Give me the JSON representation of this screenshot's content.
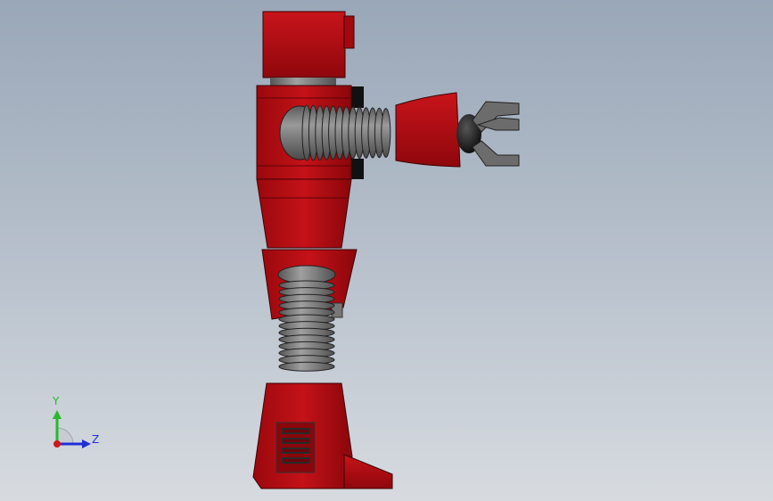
{
  "triad": {
    "y_label": "Y",
    "z_label": "Z",
    "y_color": "#2bb82b",
    "z_color": "#1e2fd8",
    "x_color": "#d01818"
  },
  "model": {
    "body_color": "#b00a0f",
    "bellows_color": "#808080",
    "claw_color": "#666666"
  }
}
